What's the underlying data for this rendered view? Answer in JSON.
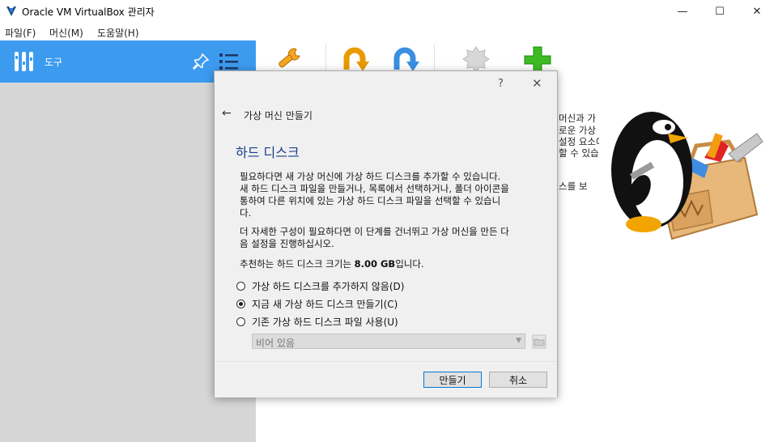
{
  "window": {
    "title": "Oracle VM VirtualBox 관리자",
    "controls": [
      "—",
      "☐",
      "✕"
    ]
  },
  "menu": [
    {
      "label": "파일(F)"
    },
    {
      "label": "머신(M)"
    },
    {
      "label": "도움말(H)"
    }
  ],
  "sidebar": {
    "tools_label": "도구"
  },
  "toolbar": {
    "icons": [
      "preferences-icon",
      "import-icon",
      "export-icon",
      "extensions-icon",
      "new-icon"
    ]
  },
  "welcome": {
    "lines_visible": [
      "머신과 가",
      "로운 가상",
      "설정 요소에",
      "할 수 있습",
      "스를 보"
    ]
  },
  "dialog": {
    "help": "?",
    "close": "✕",
    "back": "←",
    "title": "가상 머신 만들기",
    "heading": "하드 디스크",
    "p1_line1": "필요하다면 새 가상 머신에 가상 하드 디스크를 추가할 수 있습니다.",
    "p1_line2": "새 하드 디스크 파일을 만들거나, 목록에서 선택하거나, 폴더 아이콘을",
    "p1_line3": "통하여 다른 위치에 있는 가상 하드 디스크 파일을 선택할 수 있습니",
    "p1_line4": "다.",
    "p2_line1": "더 자세한 구성이 필요하다면 이 단계를 건너뛰고 가상 머신을 만든 다",
    "p2_line2": "음 설정을 진행하십시오.",
    "rec_prefix": "추천하는 하드 디스크 크기는 ",
    "rec_value": "8.00 GB",
    "rec_suffix": "입니다.",
    "options": [
      {
        "label": "가상 하드 디스크를 추가하지 않음(D)",
        "checked": false
      },
      {
        "label": "지금 새 가상 하드 디스크 만들기(C)",
        "checked": true
      },
      {
        "label": "기존 가상 하드 디스크 파일 사용(U)",
        "checked": false
      }
    ],
    "combo_value": "비어 있음",
    "buttons": {
      "create": "만들기",
      "cancel": "취소"
    }
  },
  "colors": {
    "accent": "#3d9bef",
    "heading": "#1a3f8a",
    "sidebar_bg": "#d6d6d6",
    "dialog_bg": "#f0f0f0"
  }
}
